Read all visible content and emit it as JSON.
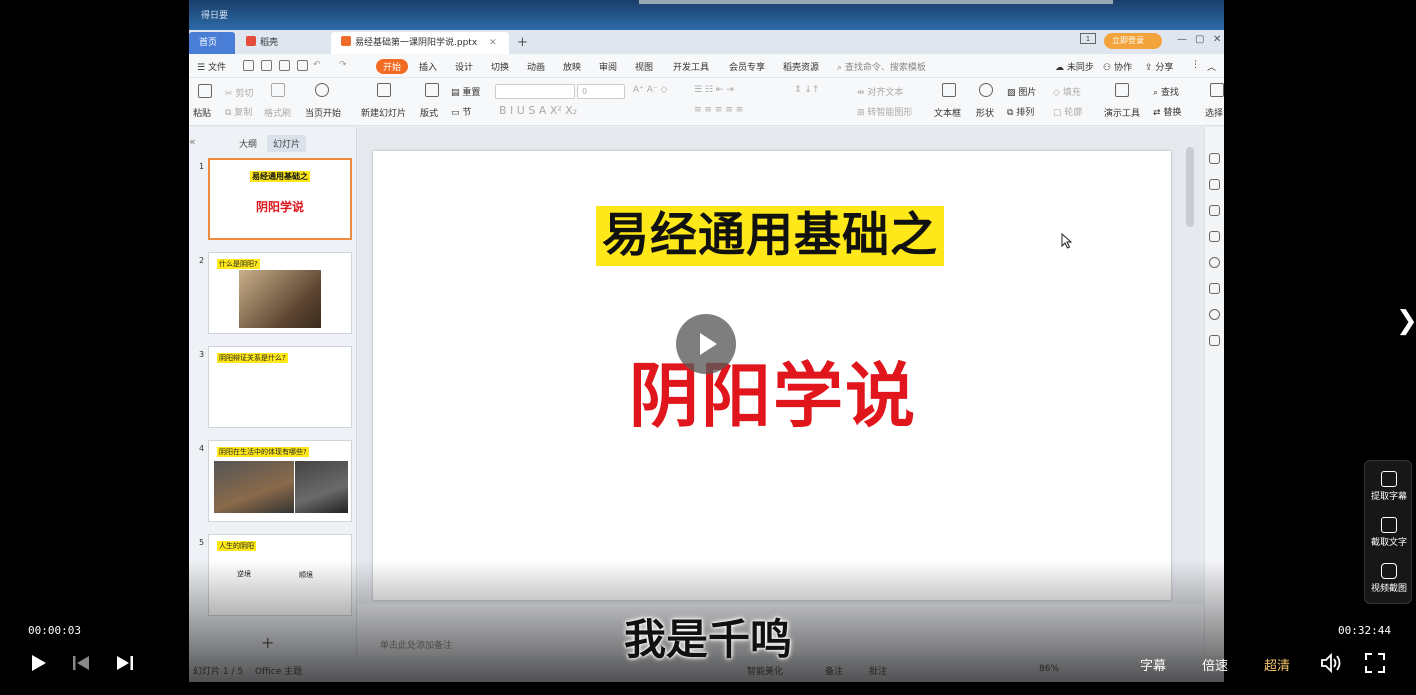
{
  "app": {
    "corner_label": "得日要",
    "tabs": [
      {
        "label": "首页"
      },
      {
        "label": "稻壳"
      },
      {
        "label": "易经基础第一课阴阳学说.pptx"
      }
    ],
    "login": "立即登录"
  },
  "menu": {
    "file": "文件",
    "items": [
      "开始",
      "插入",
      "设计",
      "切换",
      "动画",
      "放映",
      "审阅",
      "视图",
      "开发工具",
      "会员专享",
      "稻壳资源"
    ],
    "search": "查找命令、搜索模板",
    "sync": "未同步",
    "collab": "协作",
    "share": "分享"
  },
  "ribbon": {
    "paste": "粘贴",
    "cut": "剪切",
    "copy": "复制",
    "format_painter": "格式刷",
    "from_current": "当页开始",
    "new_slide": "新建幻灯片",
    "layout": "版式",
    "section": "节",
    "reset": "重置",
    "font_size": "0",
    "align_text": "对齐文本",
    "smart_shape": "转智能图形",
    "text_box": "文本框",
    "shape": "形状",
    "picture": "图片",
    "arrange": "排列",
    "fill": "填充",
    "outline": "轮廓",
    "present_tools": "演示工具",
    "find": "查找",
    "replace": "替换",
    "select": "选择"
  },
  "panel": {
    "outline": "大纲",
    "slides": "幻灯片",
    "thumbs": [
      {
        "num": "1",
        "title": "易经通用基础之",
        "sub": "阴阳学说"
      },
      {
        "num": "2",
        "title": "什么是阴阳?"
      },
      {
        "num": "3",
        "title": "阴阳辩证关系是什么?"
      },
      {
        "num": "4",
        "title": "阴阳在生活中的体现有哪些?"
      },
      {
        "num": "5",
        "title": "人生的阴阳",
        "left": "逆境",
        "right": "顺境"
      }
    ]
  },
  "slide": {
    "title": "易经通用基础之",
    "subtitle": "阴阳学说"
  },
  "notes": {
    "placeholder": "单击此处添加备注"
  },
  "status": {
    "slide_count": "幻灯片 1 / 5",
    "theme": "Office 主题",
    "beautify": "智能美化",
    "notes": "备注",
    "comments": "批注",
    "zoom": "86%"
  },
  "player": {
    "caption": "我是千鸣",
    "time_current": "00:00:03",
    "time_duration": "00:32:44",
    "subtitle_btn": "字幕",
    "speed_btn": "倍速",
    "quality_btn": "超清",
    "tools": [
      "提取字幕",
      "截取文字",
      "视频截图"
    ]
  },
  "colors": {
    "accent_orange": "#f36b22",
    "title_highlight": "#ffe81a",
    "subtitle_red": "#e0161c",
    "quality_gold": "#f5c46a"
  }
}
